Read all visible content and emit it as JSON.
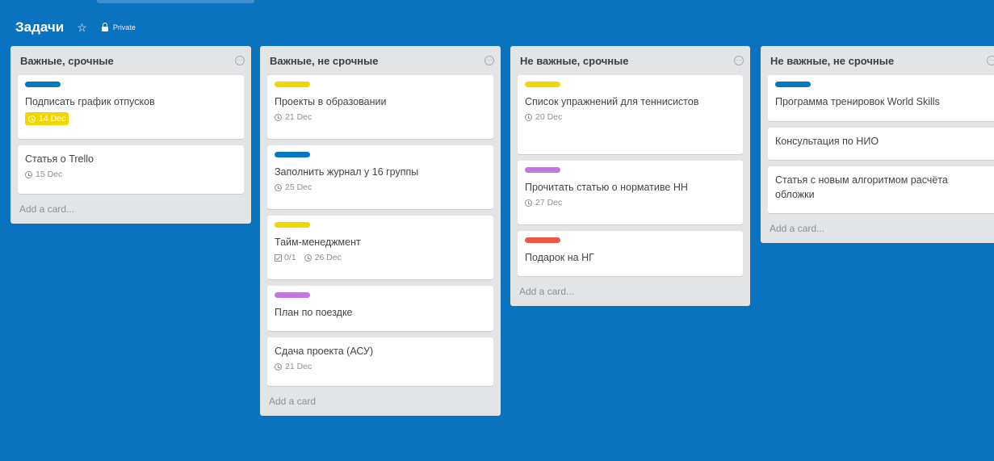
{
  "board": {
    "title": "Задачи",
    "privacy": "Private"
  },
  "colors": {
    "background": "#0a73c0",
    "blue": "#0079bf",
    "yellow": "#f2d600",
    "purple": "#c377e0",
    "red": "#eb5a46"
  },
  "lists": [
    {
      "title": "Важные, срочные",
      "add_card": "Add a card...",
      "cards": [
        {
          "label": "blue",
          "title": "Подписать график отпусков",
          "due": "14 Dec",
          "due_highlight": true
        },
        {
          "title": "Статья о Trello",
          "due": "15 Dec"
        }
      ]
    },
    {
      "title": "Важные, не срочные",
      "add_card": "Add a card",
      "cards": [
        {
          "label": "yellow",
          "title": "Проекты в образовании",
          "due": "21 Dec"
        },
        {
          "label": "blue",
          "title": "Заполнить журнал у 16 группы",
          "due": "25 Dec"
        },
        {
          "label": "yellow",
          "title": "Тайм-менеджмент",
          "checklist": "0/1",
          "due": "26 Dec"
        },
        {
          "label": "purple",
          "title": "План по поездке"
        },
        {
          "title": "Сдача проекта (АСУ)",
          "due": "21 Dec"
        }
      ]
    },
    {
      "title": "Не важные, срочные",
      "add_card": "Add a card...",
      "cards": [
        {
          "label": "yellow",
          "title": "Список упражнений для теннисистов",
          "due": "20 Dec"
        },
        {
          "label": "purple",
          "title": "Прочитать статью о нормативе НН",
          "due": "27 Dec"
        },
        {
          "label": "red",
          "title": "Подарок на НГ"
        }
      ]
    },
    {
      "title": "Не важные, не срочные",
      "add_card": "Add a card...",
      "cards": [
        {
          "label": "blue",
          "title": "Программа тренировок World Skills"
        },
        {
          "title": "Консультация по НИО"
        },
        {
          "title": "Статья с новым алгоритмом расчёта обложки"
        }
      ]
    }
  ]
}
